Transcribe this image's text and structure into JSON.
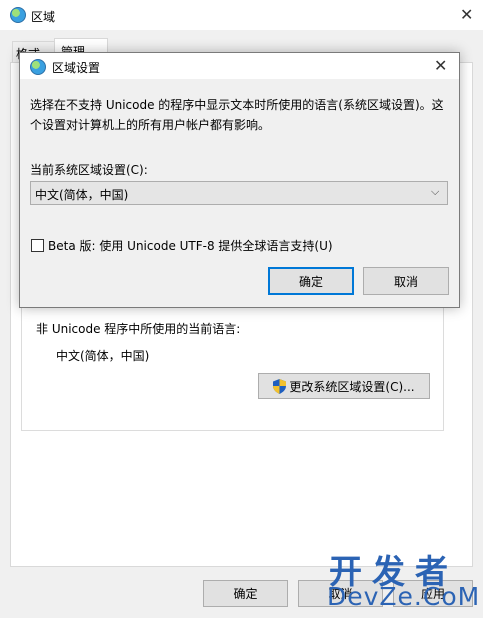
{
  "background_window": {
    "title": "区域",
    "close_glyph": "✕",
    "tabs": [
      {
        "label": "格式"
      },
      {
        "label": "管理"
      }
    ],
    "non_unicode_label": "非 Unicode 程序中所使用的当前语言:",
    "non_unicode_value": "中文(简体，中国)",
    "change_locale_button": "更改系统区域设置(C)...",
    "buttons": {
      "ok": "确定",
      "cancel": "取消",
      "apply": "应用"
    }
  },
  "dialog": {
    "title": "区域设置",
    "close_glyph": "✕",
    "description_line1": "选择在不支持 Unicode 的程序中显示文本时所使用的语言(系统区域设置)。这",
    "description_line2": "个设置对计算机上的所有用户帐户都有影响。",
    "current_locale_label": "当前系统区域设置(C):",
    "current_locale_value": "中文(简体，中国)",
    "beta_checkbox_label": "Beta 版: 使用 Unicode UTF-8 提供全球语言支持(U)",
    "beta_checked": false,
    "ok_button": "确定",
    "cancel_button": "取消"
  },
  "watermark": {
    "line1": "开发者",
    "line2": "DevZe.CoM"
  },
  "colors": {
    "accent": "#0078d7",
    "watermark": "#2b63b4"
  },
  "icons": [
    "globe-icon",
    "shield-icon",
    "close-icon",
    "chevron-down-icon"
  ]
}
